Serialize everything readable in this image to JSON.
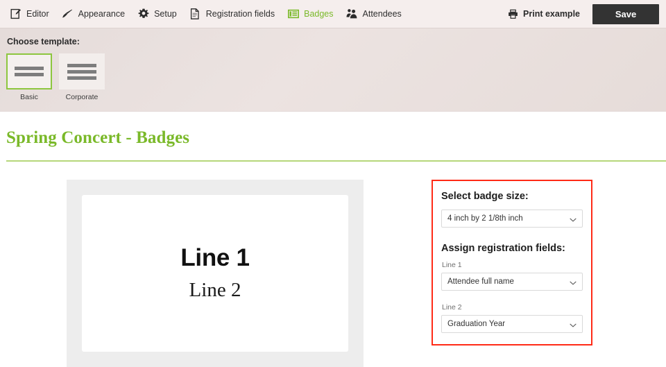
{
  "toolbar": {
    "nav": [
      {
        "label": "Editor",
        "icon": "edit-document-icon",
        "active": false
      },
      {
        "label": "Appearance",
        "icon": "paintbrush-icon",
        "active": false
      },
      {
        "label": "Setup",
        "icon": "gear-icon",
        "active": false
      },
      {
        "label": "Registration fields",
        "icon": "document-icon",
        "active": false
      },
      {
        "label": "Badges",
        "icon": "badge-lines-icon",
        "active": true
      },
      {
        "label": "Attendees",
        "icon": "people-icon",
        "active": false
      }
    ],
    "print_label": "Print example",
    "print_icon": "printer-icon",
    "save_label": "Save"
  },
  "template_chooser": {
    "label": "Choose template:",
    "options": [
      {
        "name": "Basic",
        "bars": 2,
        "selected": true
      },
      {
        "name": "Corporate",
        "bars": 3,
        "selected": false
      }
    ]
  },
  "page": {
    "title": "Spring Concert - Badges"
  },
  "badge_preview": {
    "line1": "Line 1",
    "line2": "Line 2"
  },
  "settings": {
    "badge_size_heading": "Select badge size:",
    "badge_size_value": "4 inch by 2 1/8th inch",
    "assign_fields_heading": "Assign registration fields:",
    "fields": [
      {
        "label": "Line 1",
        "value": "Attendee full name"
      },
      {
        "label": "Line 2",
        "value": "Graduation Year"
      }
    ]
  },
  "colors": {
    "brand_green": "#7ab929",
    "toolbar_bg": "#f5eeed",
    "template_band_bg": "#e9e0de",
    "save_btn_bg": "#333333",
    "highlight_red": "#ff2a16",
    "preview_bg": "#ededed"
  }
}
